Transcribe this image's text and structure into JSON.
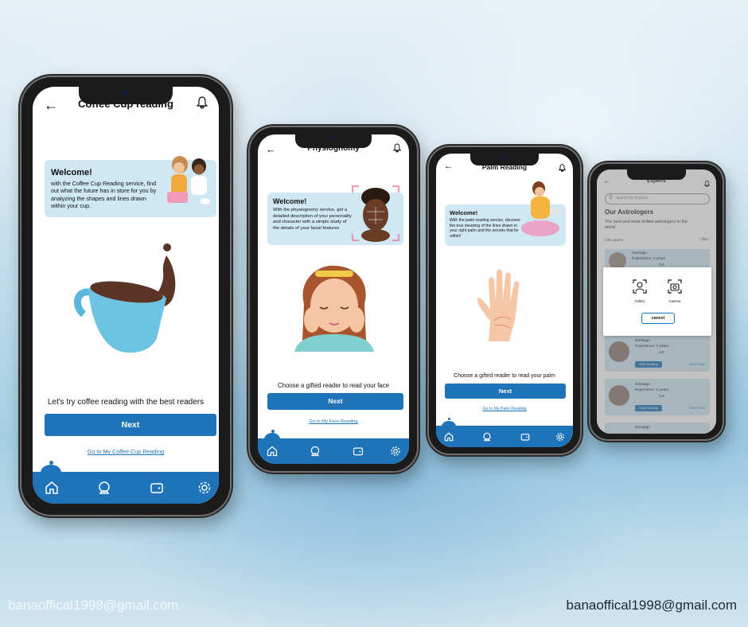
{
  "colors": {
    "primary": "#1e73b9",
    "card": "#cfe8f4",
    "text": "#111111"
  },
  "nav_icons": [
    "home-icon",
    "crystal-ball-icon",
    "wallet-icon",
    "settings-icon"
  ],
  "phones": {
    "coffee": {
      "title": "Coffee Cup reading",
      "welcome_title": "Welcome!",
      "welcome_text": "with the Coffee Cup Reading  service, find out what the future has in store for you by analyzing the shapes and lines drawn within your cup.",
      "prompt": "Let's try coffee reading with the best readers",
      "next_label": "Next",
      "link": "Go to My Coffee Cup Reading"
    },
    "physio": {
      "title": "Physiognomy",
      "welcome_title": "Welcome!",
      "welcome_text": "With the physiognomy service, get a detailed description of your personality and character with a simple study of the details of your facial features",
      "prompt": "Choose a gifted reader to read your face",
      "next_label": "Next",
      "link": "Go to My Face Reading"
    },
    "palm": {
      "title": "Palm Reading",
      "welcome_title": "Welcome!",
      "welcome_text": "With the palm reading service, discover the true meaning of the lines drawn in your right palm and the secrets that lie within!",
      "prompt": "Choose a gifted reader to read your palm",
      "next_label": "Next",
      "link": "Go to My Palm Reading"
    },
    "experts": {
      "title": "Experts",
      "search_placeholder": "search for experts",
      "heading": "Our Astrologers",
      "subheading": "The best and most skilled astrologers in the world.",
      "count": "228 experts",
      "filter": "filter",
      "experts": [
        {
          "name": "Santiago",
          "experience": "Experience: 2 years",
          "rating": "4.5"
        },
        {
          "name": "Santiago",
          "experience": "Experience: 2 years",
          "rating": "4.5",
          "start": "Start Reading",
          "profile": "View Profile"
        },
        {
          "name": "Santiago",
          "experience": "Experience: 2 years",
          "rating": "4.5",
          "start": "Start Reading",
          "profile": "View Profile"
        },
        {
          "name": "Santiago"
        }
      ],
      "modal": {
        "gallery": "Gallery",
        "camera": "Camera",
        "cancel": "cancel"
      }
    }
  },
  "watermark_left": "banaoffical1998@gmail.com",
  "watermark_right": "banaoffical1998@gmail.com"
}
